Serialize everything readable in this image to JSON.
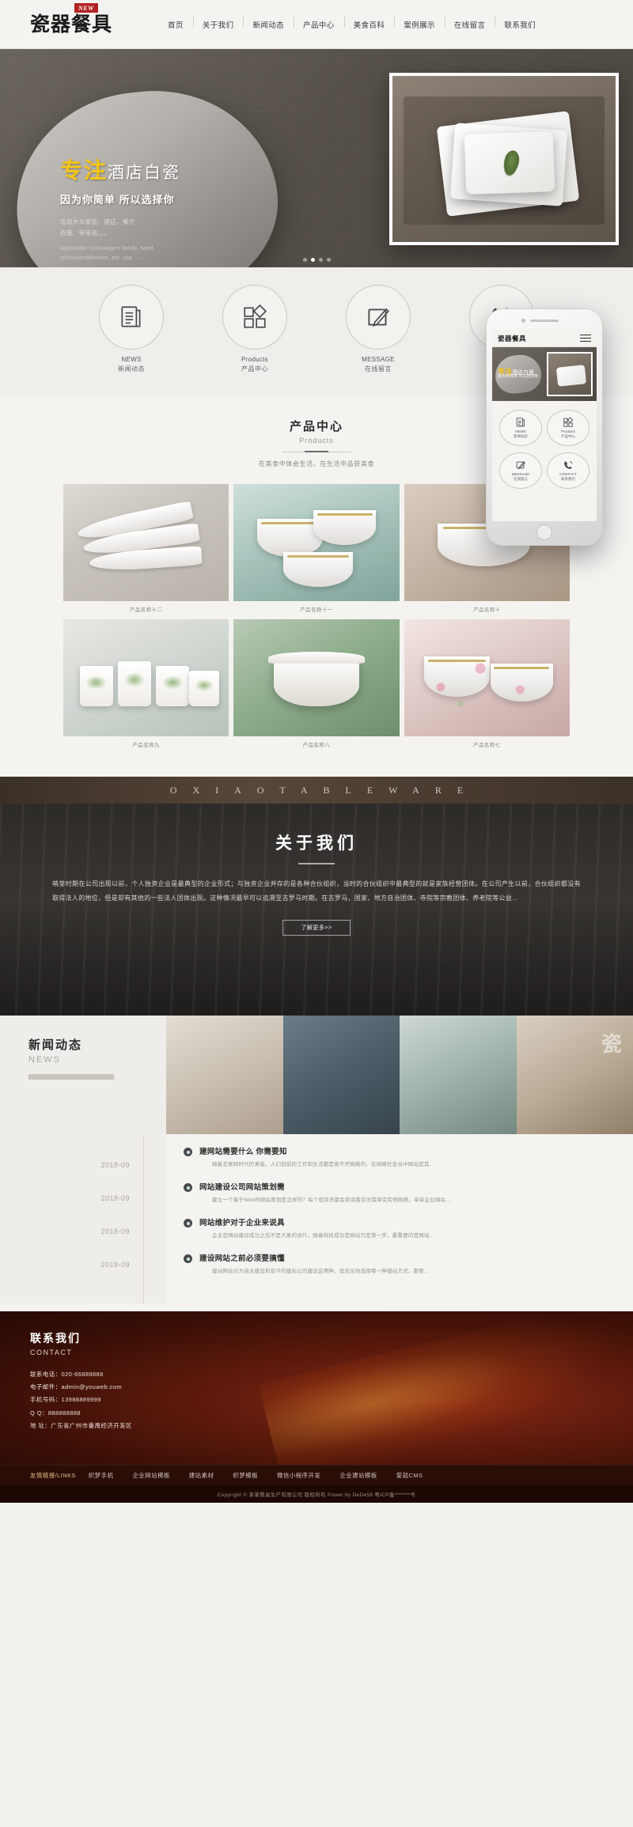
{
  "header": {
    "logo": "瓷器餐具",
    "badge": "NEW",
    "nav": [
      {
        "label": "首页"
      },
      {
        "label": "关于我们"
      },
      {
        "label": "新闻动态"
      },
      {
        "label": "产品中心"
      },
      {
        "label": "美食百科"
      },
      {
        "label": "案例展示"
      },
      {
        "label": "在线留言"
      },
      {
        "label": "联系我们"
      }
    ]
  },
  "banner": {
    "title_accent": "专注",
    "title_rest": "酒店白瓷",
    "subtitle": "因为你简单 所以选择你",
    "desc_cn_1": "适用大众家庭、酒店、餐厅",
    "desc_cn_2": "西餐、等等用。。。",
    "desc_en_1": "Applicable Volkswagen family, hotel,",
    "desc_en_2": "restaurantWestern, etc. use. . . .",
    "dots": [
      "",
      "",
      "",
      ""
    ]
  },
  "feature_icons": [
    {
      "icon": "news-document-icon",
      "en": "NEWS",
      "cn": "新闻动态"
    },
    {
      "icon": "products-grid-icon",
      "en": "Products",
      "cn": "产品中心"
    },
    {
      "icon": "message-pencil-icon",
      "en": "MESSAGE",
      "cn": "在线留言"
    },
    {
      "icon": "contact-phone-icon",
      "en": "CONTACT",
      "cn": "联系我们"
    }
  ],
  "products": {
    "title_cn": "产品中心",
    "title_en": "Products",
    "desc": "在美食中体会生活、在生活中品尝美食",
    "items": [
      {
        "caption": "产品名称十二"
      },
      {
        "caption": "产品名称十一"
      },
      {
        "caption": "产品名称十"
      },
      {
        "caption": "产品名称九"
      },
      {
        "caption": "产品名称八"
      },
      {
        "caption": "产品名称七"
      }
    ]
  },
  "letter_strip": {
    "text": "OXIAOTABLEWARE"
  },
  "about": {
    "title": "关于我们",
    "paragraph": "萌芽时期在公司出现以前，个人独资企业是最典型的企业形式；与独资企业并存的是各种合伙组织，当时的合伙组织中最典型的就是家族经营团体。在公司产生以前，合伙组织都没有取得法人的地位，但是却有其他的一些法人团体出现。这种情况最早可以追溯至古罗马时期。在古罗马，国家、地方自治团体、寺院等宗教团体、养老院等公益...",
    "button": "了解更多>>"
  },
  "news": {
    "title_cn": "新闻动态",
    "title_en": "NEWS",
    "dates": [
      "2018-09",
      "2018-09",
      "2018-09",
      "2018-09"
    ],
    "items": [
      {
        "title": "建网站需要什么 你需要知",
        "desc": "随着互联网时代的来临，人们目前的工作和生活都是离不开网络的。在网络社会当中网站是其..."
      },
      {
        "title": "网站建设公司网站策划需",
        "desc": "建立一个基于Web的网站策划是怎样的？每个程序员都会资询看有没需单完实例网络，单单企业网站..."
      },
      {
        "title": "网站维护对于企业来说具",
        "desc": "企业官网站建设成功之后不是大意的进行，随着科技成功是网站只是第一步，最重要的是网站..."
      },
      {
        "title": "建设网站之前必须要搞懂",
        "desc": "建站网站分为自主建设和现今的建站公司建设这两种，但无论你选择哪一种建站方式，都要..."
      }
    ]
  },
  "contact": {
    "title_cn": "联系我们",
    "title_en": "CONTACT",
    "lines": [
      "联系电话：020-66889888",
      "电子邮件：admin@youweb.com",
      "手机号码：13988889999",
      "Q  Q：888888888",
      "地  址：广东省广州市番禺经济开发区"
    ]
  },
  "links": {
    "title": "友情链接/LINKS",
    "items": [
      "织梦手机",
      "企业网站模板",
      "建站素材",
      "织梦模板",
      "微信小程序开发",
      "企业建站模板",
      "爱就CMS"
    ]
  },
  "copyright": {
    "text": "Copyright © 某某餐具生产有限公司 版权所有 Power by DeDe58           粤ICP备*******号"
  }
}
